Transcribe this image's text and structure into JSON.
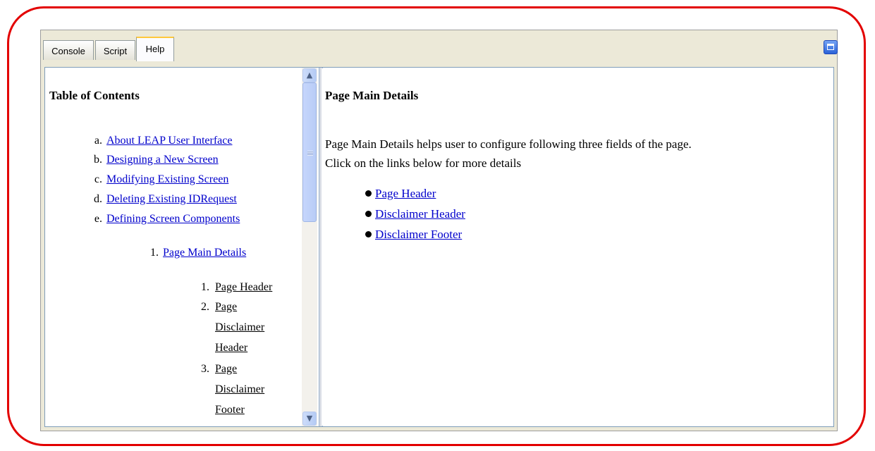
{
  "tabs": [
    {
      "label": "Console",
      "active": false
    },
    {
      "label": "Script",
      "active": false
    },
    {
      "label": "Help",
      "active": true
    }
  ],
  "toc": {
    "title": "Table of Contents",
    "level1": [
      {
        "marker": "a.",
        "label": "About LEAP User Interface"
      },
      {
        "marker": "b.",
        "label": "Designing a New Screen"
      },
      {
        "marker": "c.",
        "label": "Modifying Existing Screen"
      },
      {
        "marker": "d.",
        "label": "Deleting Existing IDRequest"
      },
      {
        "marker": "e.",
        "label": "Defining Screen Components"
      }
    ],
    "level2": [
      {
        "marker": "1.",
        "label": "Page Main Details"
      }
    ],
    "level3": [
      {
        "marker": "1.",
        "lines": [
          "Page Header"
        ]
      },
      {
        "marker": "2.",
        "lines": [
          "Page",
          "Disclaimer",
          "Header"
        ]
      },
      {
        "marker": "3.",
        "lines": [
          "Page",
          "Disclaimer",
          "Footer"
        ]
      }
    ]
  },
  "content": {
    "heading": "Page Main Details",
    "paragraph_line1": "Page Main Details helps user to configure following three fields of the page.",
    "paragraph_line2": "Click on the links below for more details",
    "links": [
      "Page Header",
      "Disclaimer Header",
      "Disclaimer Footer"
    ]
  },
  "colors": {
    "frame": "#e30000",
    "link": "#0000cc",
    "tab_highlight": "#ffc83c"
  }
}
